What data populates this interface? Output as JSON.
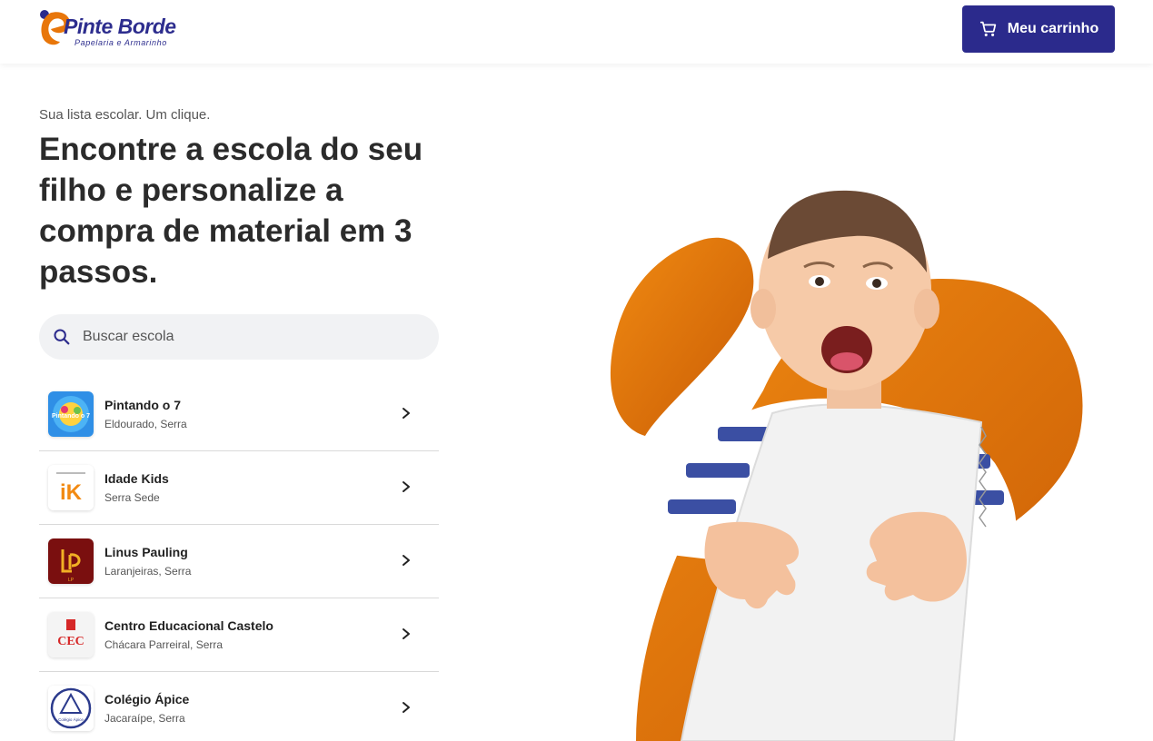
{
  "brand": {
    "name": "Pinte Borde",
    "subtitle": "Papelaria e Armarinho",
    "primary_color": "#2b2a8c",
    "accent_color": "#e8760a"
  },
  "header": {
    "cart_label": "Meu carrinho",
    "cart_icon": "shopping-cart-icon"
  },
  "main": {
    "tagline": "Sua lista escolar. Um clique.",
    "headline": "Encontre a escola do seu filho e personalize a compra de material em 3 passos.",
    "search": {
      "placeholder": "Buscar escola",
      "value": "",
      "icon": "search-icon"
    },
    "schools": [
      {
        "name": "Pintando o 7",
        "location": "Eldourado, Serra",
        "logo_text": "Pintando o 7"
      },
      {
        "name": "Idade Kids",
        "location": "Serra Sede",
        "logo_text": "iK"
      },
      {
        "name": "Linus Pauling",
        "location": "Laranjeiras, Serra",
        "logo_text": "LP"
      },
      {
        "name": "Centro Educacional Castelo",
        "location": "Chácara Parreiral, Serra",
        "logo_text": "CEC"
      },
      {
        "name": "Colégio Ápice",
        "location": "Jacaraípe, Serra",
        "logo_text": "Colégio Ápice"
      }
    ]
  }
}
